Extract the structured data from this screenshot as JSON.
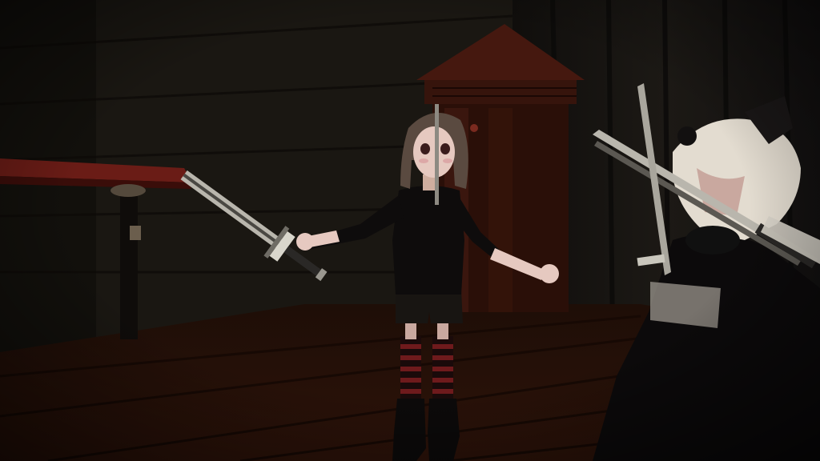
{
  "scene": {
    "palette": {
      "wall": "#1b1813",
      "wall_shadow": "#0d0b08",
      "curtain": "#171411",
      "floor": "#2a1208",
      "floor_light": "#3d1a0c",
      "table_top": "#5e1a14",
      "cabinet": "#3a160e",
      "skin": "#e6c9c0",
      "hair_brown": "#5a4a40",
      "outfit": "#0e0c0c",
      "stocking_red": "#6e1a1c",
      "blade": "#b9b6ad",
      "white_hair": "#e3dcd0",
      "cheek": "#d9a0a0"
    }
  }
}
